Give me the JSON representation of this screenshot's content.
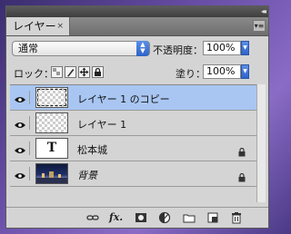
{
  "panel": {
    "tab_label": "レイヤー",
    "tab_close": "×",
    "collapse_glyph": "◂◂",
    "menu_glyph": "▾≡"
  },
  "options": {
    "blend_mode": "通常",
    "opacity_label": "不透明度：",
    "opacity_value": "100%",
    "lock_label": "ロック：",
    "fill_label": "塗り：",
    "fill_value": "100%"
  },
  "layers": [
    {
      "name": "レイヤー 1 のコピー",
      "thumb": "transparent",
      "selected": true,
      "locked": false,
      "visible": true
    },
    {
      "name": "レイヤー 1",
      "thumb": "transparent",
      "selected": false,
      "locked": false,
      "visible": true
    },
    {
      "name": "松本城",
      "thumb": "text",
      "thumb_glyph": "T",
      "selected": false,
      "locked": true,
      "visible": true
    },
    {
      "name": "背景",
      "thumb": "photo",
      "selected": false,
      "locked": true,
      "visible": true,
      "italic": true
    }
  ],
  "bottom_icons": [
    "link-icon",
    "fx-icon",
    "mask-icon",
    "adjustment-icon",
    "folder-icon",
    "new-layer-icon",
    "trash-icon"
  ],
  "bottom_fx_label": "fx."
}
